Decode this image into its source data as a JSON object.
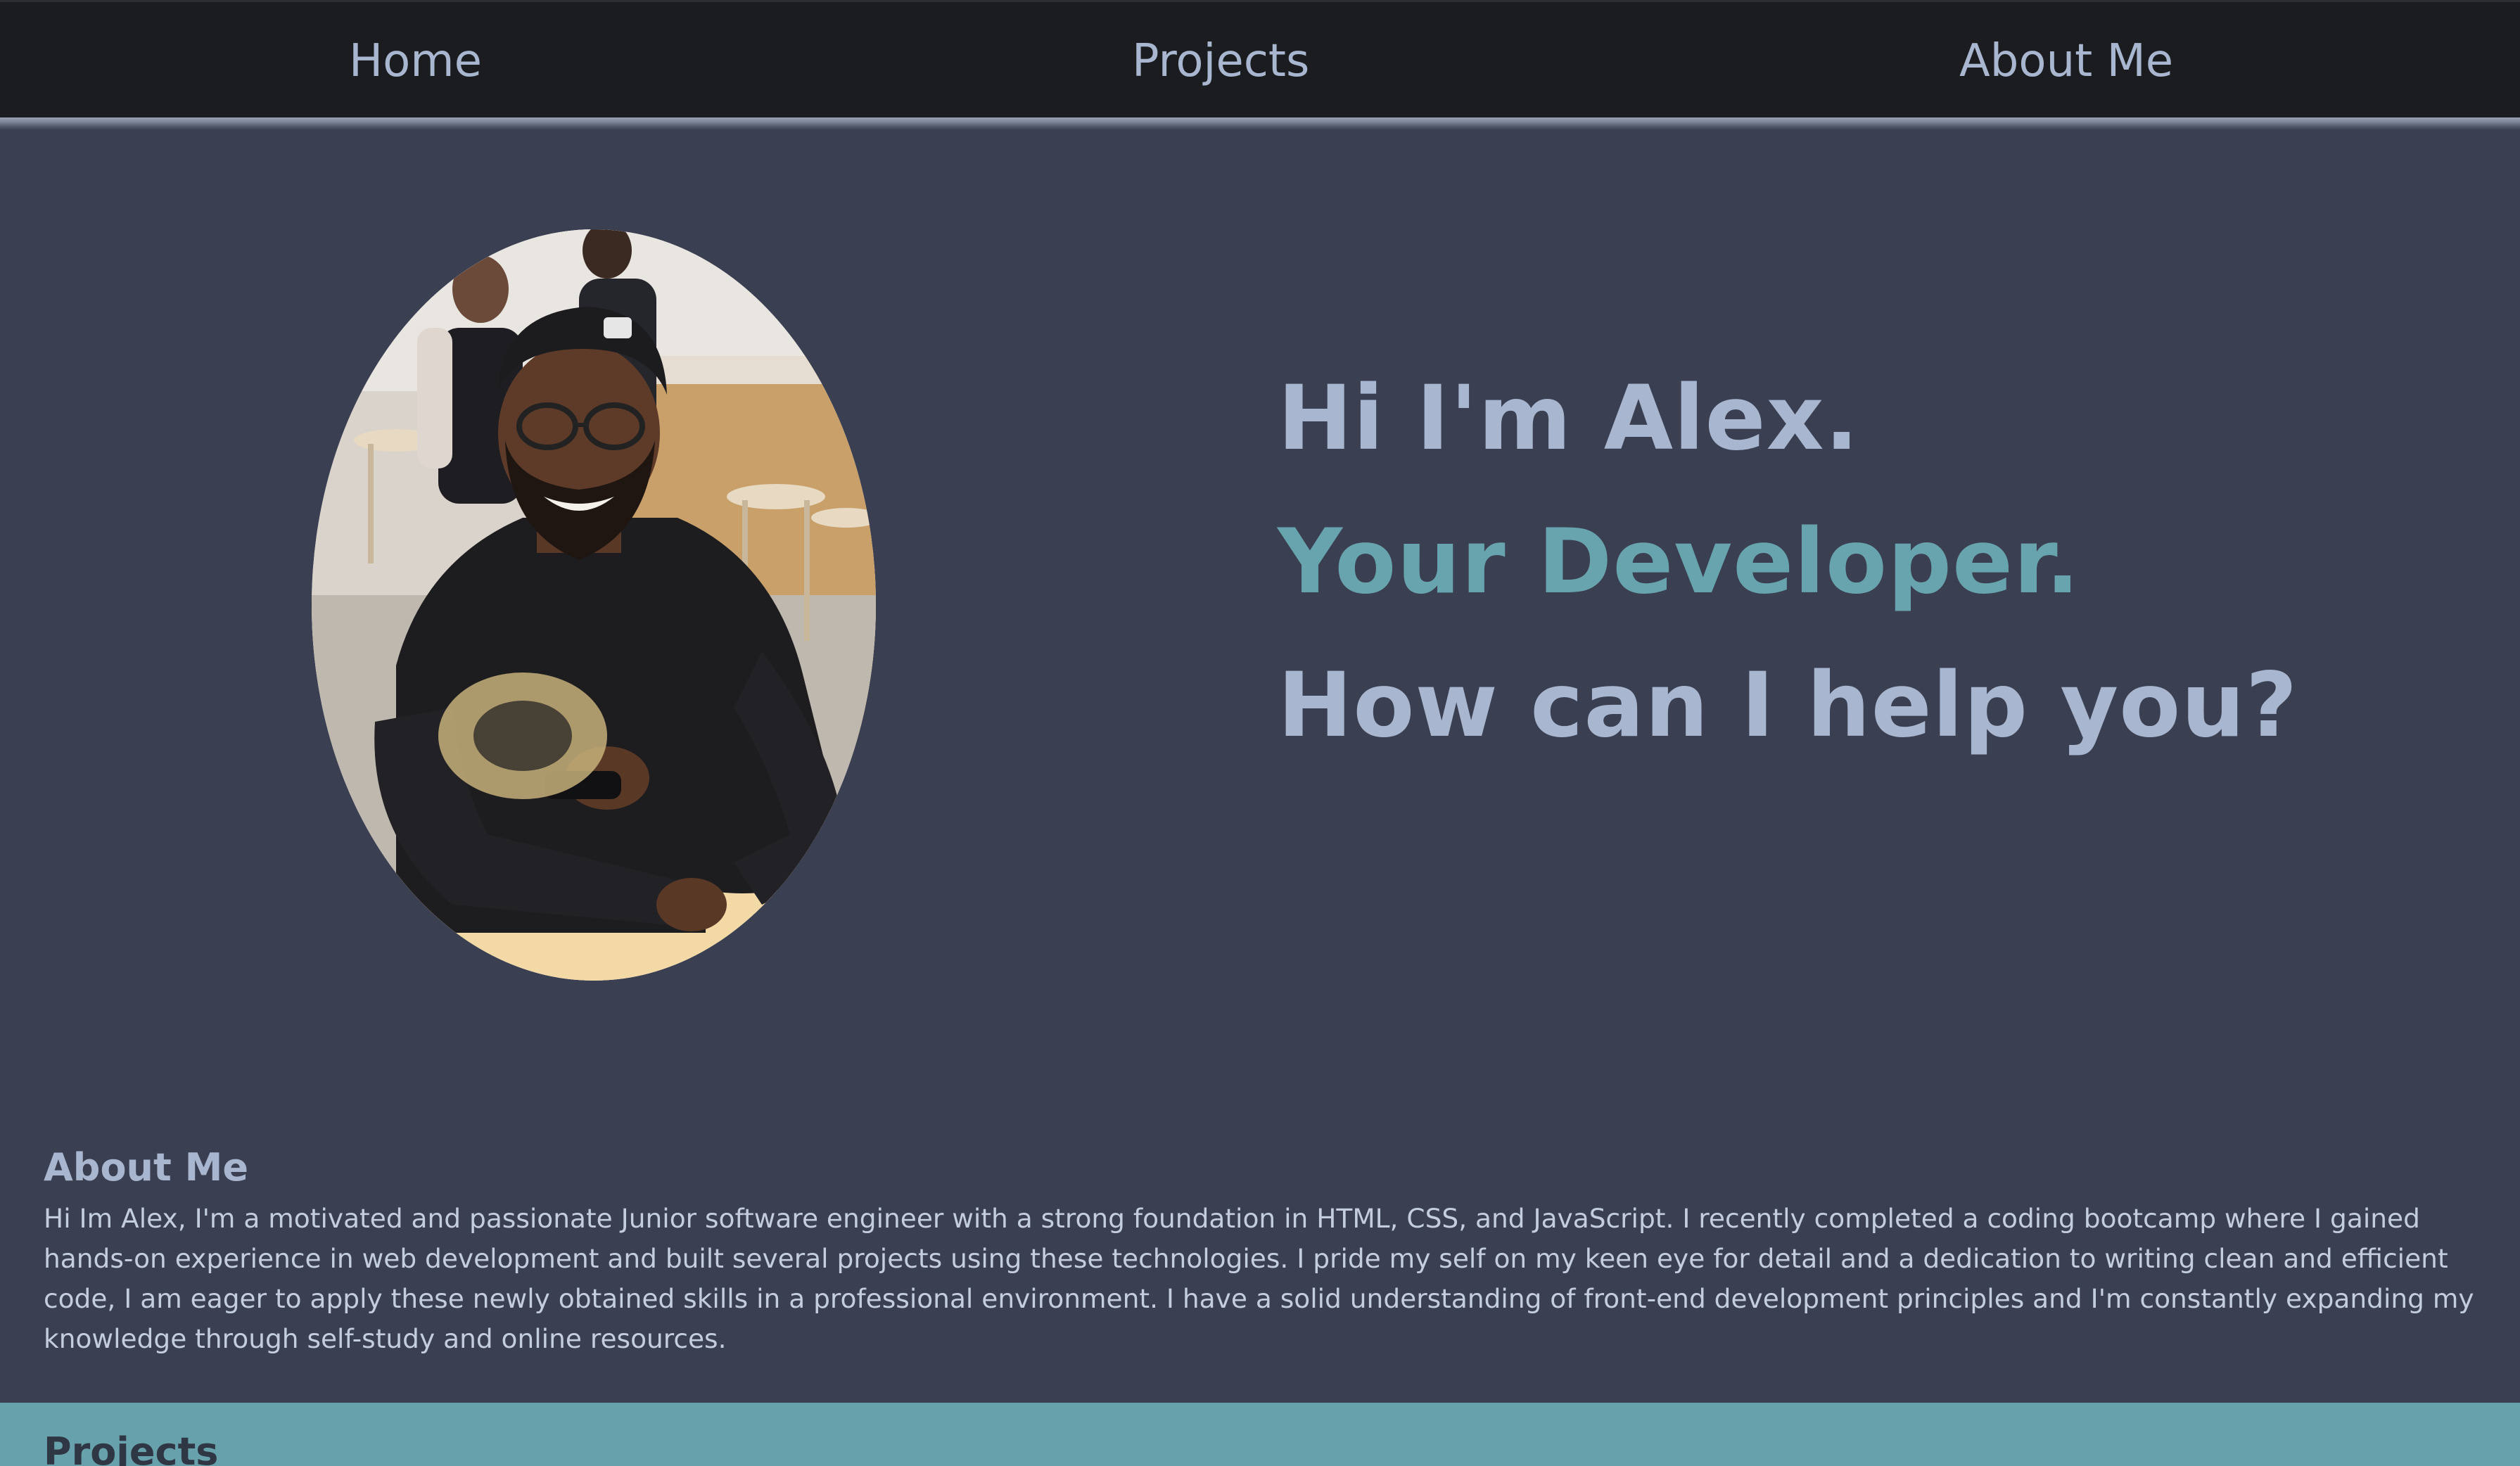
{
  "nav": {
    "home": "Home",
    "projects": "Projects",
    "about": "About Me"
  },
  "hero": {
    "line1": "Hi I'm Alex.",
    "line2": "Your Developer.",
    "line3": "How can I help you?"
  },
  "about": {
    "heading": "About Me",
    "text": "Hi Im Alex, I'm a motivated and passionate Junior software engineer with a strong foundation in HTML, CSS, and JavaScript. I recently completed a coding bootcamp where I gained hands-on experience in web development and built several projects using these technologies. I pride my self on my keen eye for detail and a dedication to writing clean and efficient code, I am eager to apply these newly obtained skills in a professional environment. I have a solid understanding of front-end development principles and I'm constantly expanding my knowledge through self-study and online resources."
  },
  "projects": {
    "heading": "Projects"
  },
  "colors": {
    "navbar_bg": "#1b1c1f",
    "page_bg": "#3a3f51",
    "text_primary": "#a8b6cf",
    "accent": "#68a4ae",
    "projects_bg": "#67a1ac"
  }
}
